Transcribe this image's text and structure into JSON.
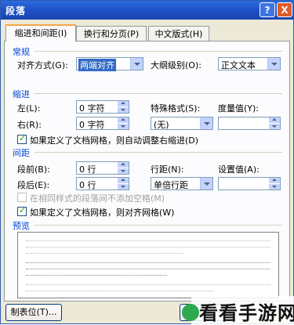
{
  "window": {
    "title": "段落",
    "help": "?",
    "close": "X"
  },
  "tabs": [
    "缩进和间距(I)",
    "换行和分页(P)",
    "中文版式(H)"
  ],
  "general": {
    "section": "常规",
    "align_label": "对齐方式(G):",
    "align_value": "两端对齐",
    "outline_label": "大纲级别(O):",
    "outline_value": "正文文本"
  },
  "indent": {
    "section": "缩进",
    "left_label": "左(L):",
    "left_value": "0 字符",
    "right_label": "右(R):",
    "right_value": "0 字符",
    "special_label": "特殊格式(S):",
    "special_value": "(无)",
    "measure_label": "度量值(Y):",
    "measure_value": "",
    "auto_adjust_label": "如果定义了文档网格，则自动调整右缩进(D)",
    "auto_adjust_checked": true
  },
  "spacing": {
    "section": "间距",
    "before_label": "段前(B):",
    "before_value": "0 行",
    "after_label": "段后(E):",
    "after_value": "0 行",
    "line_label": "行距(N):",
    "line_value": "单倍行距",
    "setting_label": "设置值(A):",
    "setting_value": "",
    "no_space_label": "在相同样式的段落间不添加空格(M)",
    "no_space_checked": false,
    "snap_grid_label": "如果定义了文档网格，则对齐网格(W)",
    "snap_grid_checked": true
  },
  "preview": {
    "section": "预览"
  },
  "footer": {
    "tabs_button": "制表位(T)...",
    "ok_partial": "确"
  },
  "watermark": {
    "text": "看看手游网"
  },
  "colors": {
    "titlebar": "#1c4fc2",
    "section": "#0046d5",
    "dialog": "#ece9d8",
    "selection": "#316ac5"
  }
}
